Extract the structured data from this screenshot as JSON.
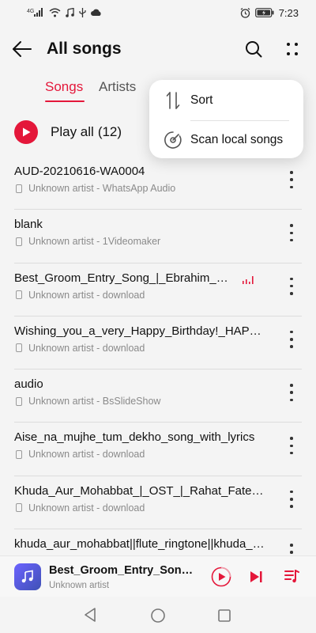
{
  "status_bar": {
    "network_label": "4G",
    "time": "7:23",
    "icons": [
      "signal-icon",
      "wifi-icon",
      "music-note-icon",
      "usb-icon",
      "cloud-icon",
      "alarm-icon",
      "battery-icon"
    ]
  },
  "header": {
    "title": "All songs",
    "icons": [
      "back-arrow-icon",
      "search-icon",
      "more-vertical-icon"
    ]
  },
  "tabs": [
    {
      "label": "Songs",
      "active": true
    },
    {
      "label": "Artists",
      "active": false
    }
  ],
  "play_all": {
    "label": "Play all",
    "count": "(12)"
  },
  "songs": [
    {
      "title": "AUD-20210616-WA0004",
      "subtitle": "Unknown artist - WhatsApp Audio",
      "playing": false
    },
    {
      "title": "blank",
      "subtitle": "Unknown artist - 1Videomaker",
      "playing": false
    },
    {
      "title": "Best_Groom_Entry_Song_|_Ebrahim_Mama|Sheikh_ruhul",
      "subtitle": "Unknown artist - download",
      "playing": true
    },
    {
      "title": "Wishing_you_a_very_Happy_Birthday!_HAPPY_BIRTHDAY",
      "subtitle": "Unknown artist - download",
      "playing": false
    },
    {
      "title": "audio",
      "subtitle": "Unknown artist - BsSlideShow",
      "playing": false
    },
    {
      "title": "Aise_na_mujhe_tum_dekho_song_with_lyrics",
      "subtitle": "Unknown artist - download",
      "playing": false
    },
    {
      "title": "Khuda_Aur_Mohabbat_|_OST_|_Rahat_Fateh_Ali_Khan",
      "subtitle": "Unknown artist - download",
      "playing": false
    },
    {
      "title": "khuda_aur_mohabbat||flute_ringtone||khuda_aur",
      "subtitle": "",
      "playing": false
    }
  ],
  "popup_menu": {
    "items": [
      {
        "label": "Sort",
        "icon": "sort-icon"
      },
      {
        "label": "Scan local songs",
        "icon": "scan-disc-icon"
      }
    ]
  },
  "mini_player": {
    "title": "Best_Groom_Entry_Song_|_Ebrahim_Mama",
    "artist": "Unknown artist",
    "icons": [
      "music-art-icon",
      "play-pause-icon",
      "next-icon",
      "queue-icon"
    ]
  },
  "colors": {
    "accent": "#e4173a",
    "background": "#f4f4f4",
    "menu_background": "#ffffff",
    "secondary_text": "#8a8a8a"
  }
}
